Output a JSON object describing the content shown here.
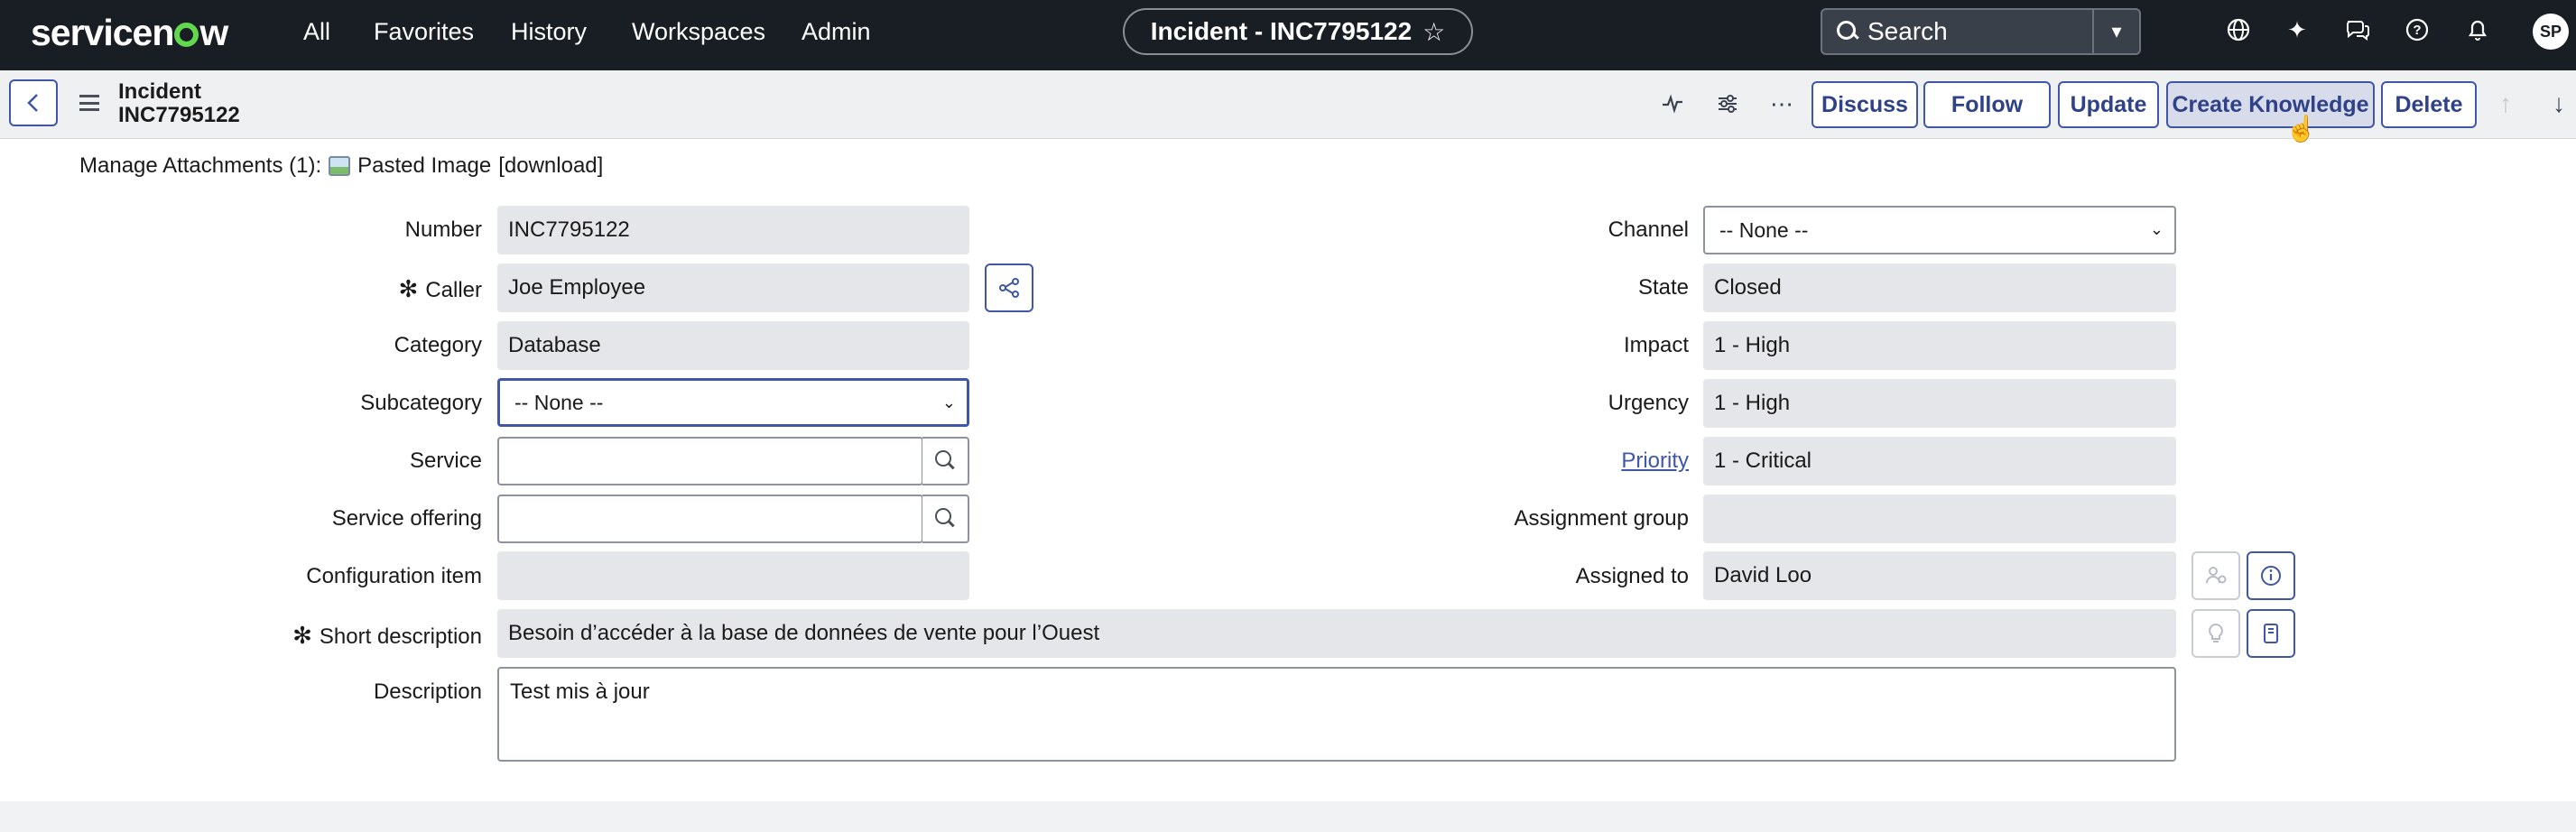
{
  "app": {
    "brand": "servicenow",
    "nav": [
      "All",
      "Favorites",
      "History",
      "Workspaces",
      "Admin"
    ],
    "context_pill": "Incident - INC7795122",
    "search_placeholder": "Search",
    "user_initials": "SP"
  },
  "header": {
    "title_line1": "Incident",
    "title_line2": "INC7795122",
    "buttons": {
      "discuss": "Discuss",
      "follow": "Follow",
      "update": "Update",
      "create_knowledge": "Create Knowledge",
      "delete": "Delete"
    }
  },
  "attachments": {
    "label": "Manage Attachments (1):",
    "file": "Pasted Image",
    "download": "[download]"
  },
  "form": {
    "left": {
      "number": {
        "label": "Number",
        "value": "INC7795122"
      },
      "caller": {
        "label": "Caller",
        "value": "Joe Employee",
        "required": true
      },
      "category": {
        "label": "Category",
        "value": "Database"
      },
      "subcategory": {
        "label": "Subcategory",
        "value": "-- None --"
      },
      "service": {
        "label": "Service",
        "value": ""
      },
      "service_offering": {
        "label": "Service offering",
        "value": ""
      },
      "configuration_item": {
        "label": "Configuration item",
        "value": ""
      }
    },
    "right": {
      "channel": {
        "label": "Channel",
        "value": "-- None --"
      },
      "state": {
        "label": "State",
        "value": "Closed"
      },
      "impact": {
        "label": "Impact",
        "value": "1 - High"
      },
      "urgency": {
        "label": "Urgency",
        "value": "1 - High"
      },
      "priority": {
        "label": "Priority",
        "value": "1 - Critical"
      },
      "assignment_group": {
        "label": "Assignment group",
        "value": ""
      },
      "assigned_to": {
        "label": "Assigned to",
        "value": "David Loo"
      }
    },
    "short_description": {
      "label": "Short description",
      "value": "Besoin d’accéder à la base de données de vente pour l’Ouest",
      "required": true
    },
    "description": {
      "label": "Description",
      "value": "Test mis à jour"
    }
  }
}
